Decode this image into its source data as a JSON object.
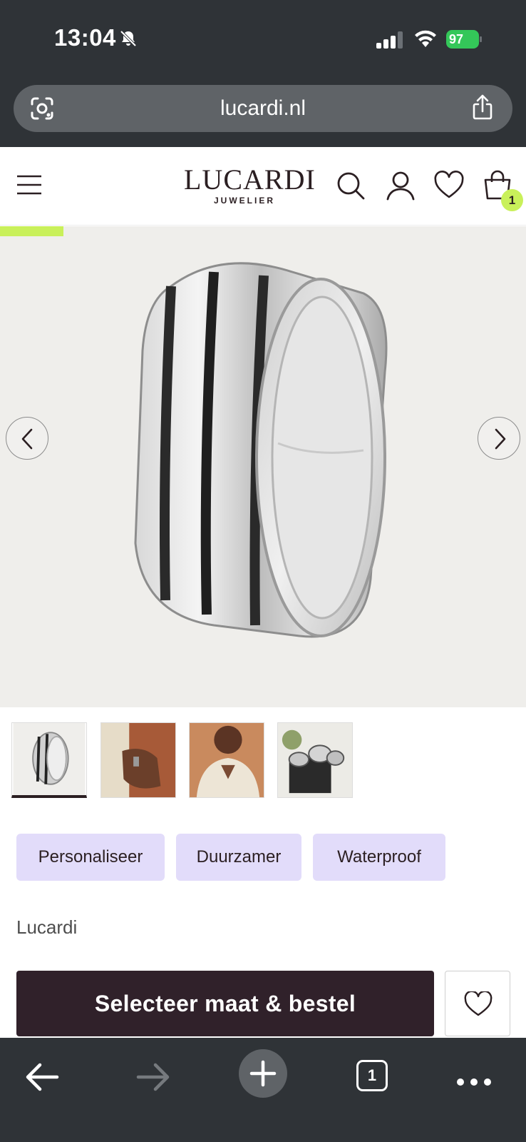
{
  "status_bar": {
    "time": "13:04",
    "battery": "97"
  },
  "browser": {
    "url": "lucardi.nl",
    "tab_count": "1"
  },
  "header": {
    "logo_main": "LUCARDI",
    "logo_sub": "JUWELIER",
    "cart_count": "1"
  },
  "gallery": {
    "progress": 0.12,
    "thumbnail_count": 4,
    "active_thumbnail": 0
  },
  "tags": [
    "Personaliseer",
    "Duurzamer",
    "Waterproof"
  ],
  "product": {
    "brand": "Lucardi"
  },
  "cta": {
    "order_label": "Selecteer maat & bestel"
  },
  "colors": {
    "accent": "#c9f05a",
    "primary": "#30212a",
    "tag_bg": "#e2dcfa",
    "browser_chrome": "#2f3337"
  }
}
